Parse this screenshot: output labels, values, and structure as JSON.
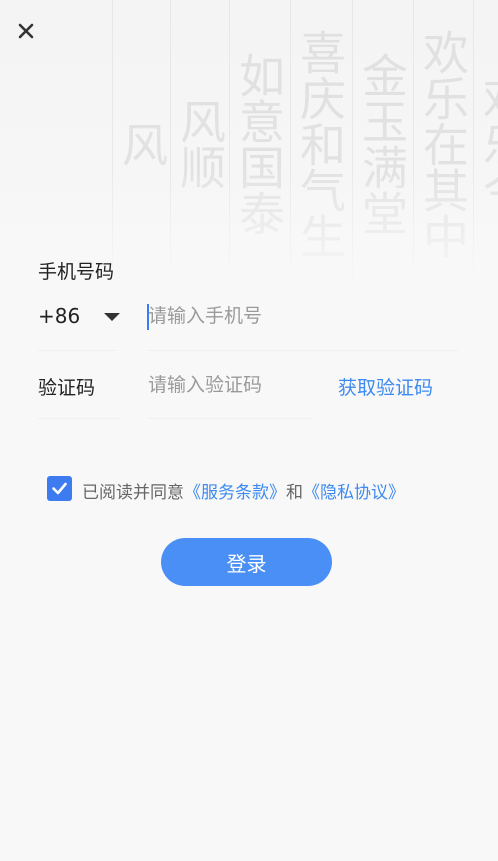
{
  "header": {
    "close_icon": "close-icon"
  },
  "phone": {
    "label": "手机号码",
    "country_code": "+86",
    "placeholder": "请输入手机号",
    "value": ""
  },
  "code": {
    "label": "验证码",
    "placeholder": "请输入验证码",
    "value": "",
    "get_code_label": "获取验证码"
  },
  "agreement": {
    "checked": true,
    "prefix": "已阅读并同意",
    "terms_link": "《服务条款》",
    "connector": "和",
    "privacy_link": "《隐私协议》"
  },
  "login": {
    "label": "登录"
  },
  "colors": {
    "accent": "#4a8ff5",
    "link": "#3d8af0",
    "text": "#222222",
    "placeholder": "#9a9a9a",
    "background": "#f8f8f8"
  }
}
